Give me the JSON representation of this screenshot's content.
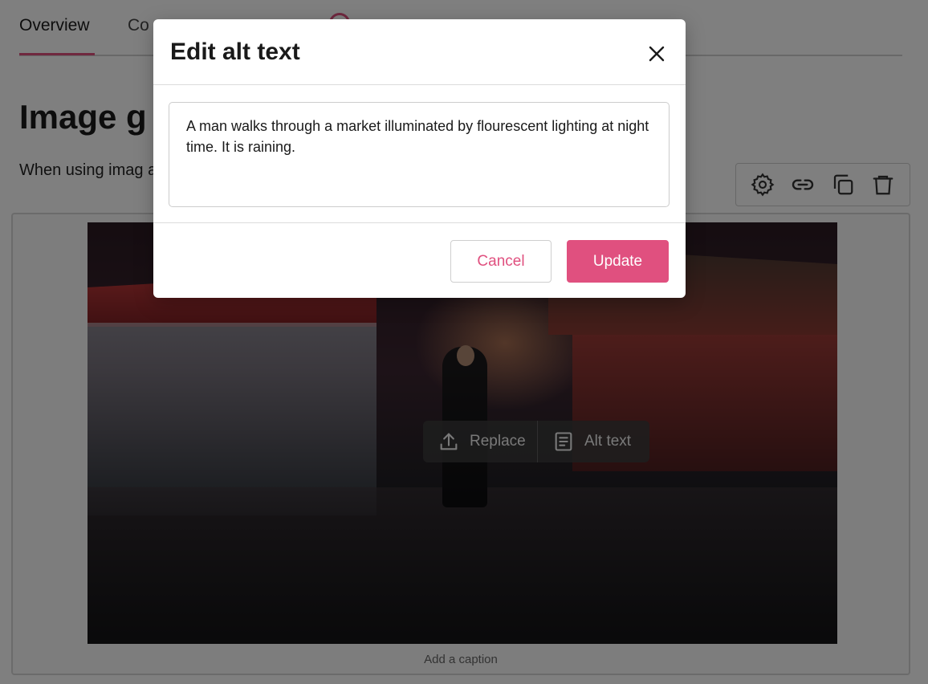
{
  "tabs": [
    {
      "label": "Overview"
    },
    {
      "label": "Co"
    }
  ],
  "page": {
    "heading": "Image g",
    "intro": "When using imag and guidelines."
  },
  "image_toolbar": {
    "replace_label": "Replace",
    "alt_text_label": "Alt text"
  },
  "image": {
    "caption_placeholder": "Add a caption"
  },
  "block_toolbar": {
    "icons": [
      "gear-icon",
      "link-icon",
      "duplicate-icon",
      "trash-icon"
    ]
  },
  "modal": {
    "title": "Edit alt text",
    "alt_text_value": "A man walks through a market illuminated by flourescent lighting at night time. It is raining.",
    "cancel_label": "Cancel",
    "update_label": "Update"
  },
  "colors": {
    "accent": "#e0507f",
    "overlay": "rgba(0,0,0,0.5)"
  }
}
